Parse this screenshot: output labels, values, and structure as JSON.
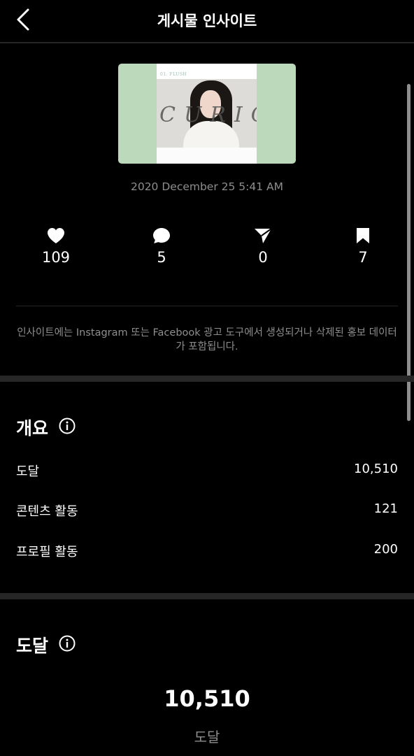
{
  "header": {
    "title": "게시물 인사이트"
  },
  "post": {
    "thumbnail_brand": "01. FLUSH",
    "thumbnail_script": "CURIOS",
    "date": "2020 December 25 5:41 AM"
  },
  "stats": [
    {
      "icon": "heart-icon",
      "value": "109"
    },
    {
      "icon": "comment-icon",
      "value": "5"
    },
    {
      "icon": "share-icon",
      "value": "0"
    },
    {
      "icon": "bookmark-icon",
      "value": "7"
    }
  ],
  "notice": "인사이트에는 Instagram 또는 Facebook 광고 도구에서 생성되거나 삭제된 홍보 데이터가 포함됩니다.",
  "overview": {
    "title": "개요",
    "rows": [
      {
        "label": "도달",
        "value": "10,510"
      },
      {
        "label": "콘텐츠 활동",
        "value": "121"
      },
      {
        "label": "프로필 활동",
        "value": "200"
      }
    ]
  },
  "reach": {
    "title": "도달",
    "big_value": "10,510",
    "big_label": "도달"
  },
  "colors": {
    "background": "#000000",
    "text": "#ffffff",
    "muted": "#8e8e8e",
    "divider": "#262626",
    "thumbnail_bg": "#bcd9bc"
  }
}
